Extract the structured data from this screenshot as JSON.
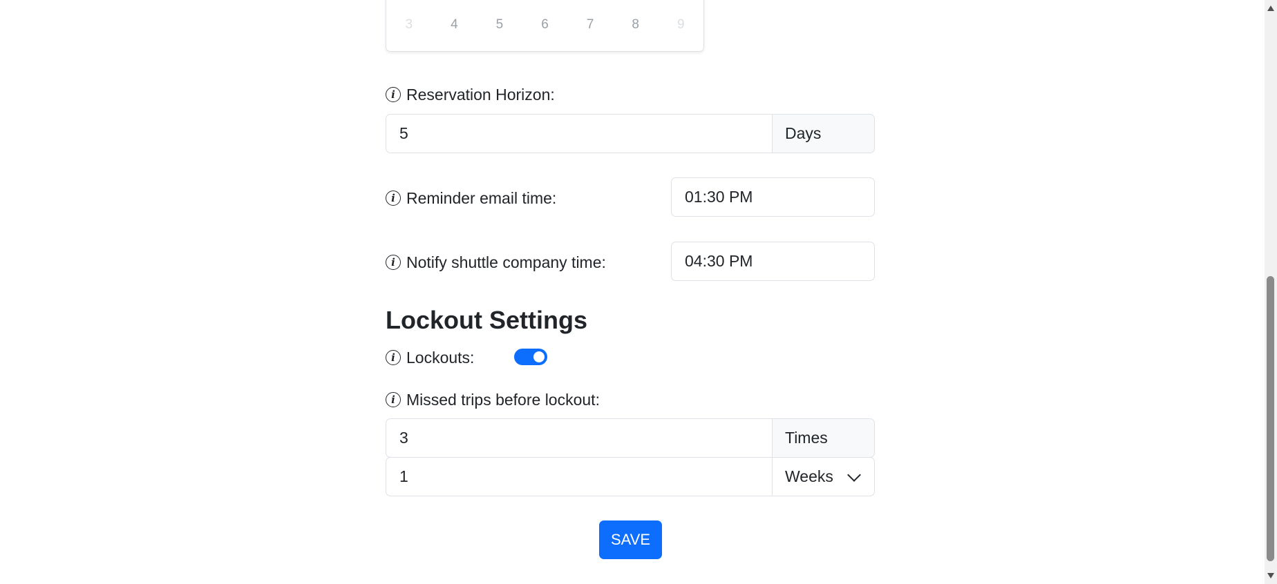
{
  "calendar": {
    "visible_days": [
      {
        "label": "3",
        "muted": true
      },
      {
        "label": "4",
        "muted": false
      },
      {
        "label": "5",
        "muted": false
      },
      {
        "label": "6",
        "muted": false
      },
      {
        "label": "7",
        "muted": false
      },
      {
        "label": "8",
        "muted": false
      },
      {
        "label": "9",
        "muted": true
      }
    ]
  },
  "reservation_horizon": {
    "label": "Reservation Horizon:",
    "value": "5",
    "unit": "Days"
  },
  "reminder_email": {
    "label": "Reminder email time:",
    "value": "01:30 PM"
  },
  "notify_shuttle": {
    "label": "Notify shuttle company time:",
    "value": "04:30 PM"
  },
  "lockout_section": {
    "title": "Lockout Settings",
    "lockouts_label": "Lockouts:",
    "lockouts_enabled": true,
    "missed_trips_label": "Missed trips before lockout:",
    "missed_trips_value": "3",
    "missed_trips_unit": "Times",
    "period_value": "1",
    "period_unit": "Weeks"
  },
  "actions": {
    "save_label": "SAVE"
  },
  "colors": {
    "accent": "#0d6efd",
    "text": "#212529",
    "border": "#dee2e6",
    "addon_bg": "#f8f9fa"
  },
  "icons": {
    "info": "info-circle-icon",
    "dropdown": "chevron-down-icon"
  }
}
